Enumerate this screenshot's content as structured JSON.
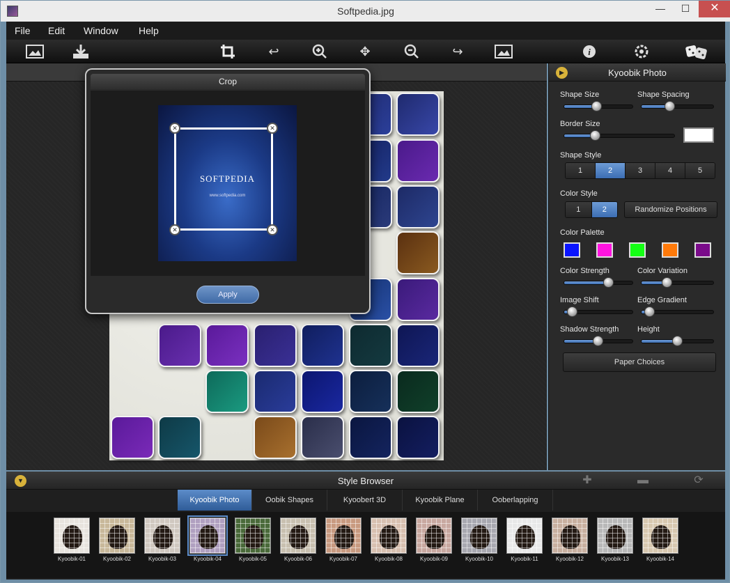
{
  "window": {
    "title": "Softpedia.jpg",
    "minimize": "—",
    "maximize": "☐",
    "close": "✕"
  },
  "menu": [
    "File",
    "Edit",
    "Window",
    "Help"
  ],
  "toolbar": {
    "icons": [
      "open-image-icon",
      "save-icon",
      "crop-icon",
      "undo-icon",
      "zoom-in-icon",
      "move-icon",
      "zoom-out-icon",
      "redo-icon",
      "export-image-icon",
      "info-icon",
      "settings-icon",
      "dice-icon"
    ]
  },
  "crop": {
    "title": "Crop",
    "image_logo": "SOFTPEDIA",
    "image_url": "www.softpedia.com",
    "apply_label": "Apply"
  },
  "panel": {
    "title": "Kyoobik Photo",
    "shape_size": {
      "label": "Shape Size",
      "value": 0.47
    },
    "shape_spacing": {
      "label": "Shape Spacing",
      "value": 0.38
    },
    "border_size": {
      "label": "Border Size",
      "value": 0.26
    },
    "shape_style": {
      "label": "Shape Style",
      "options": [
        "1",
        "2",
        "3",
        "4",
        "5"
      ],
      "selected": "2"
    },
    "color_style": {
      "label": "Color Style",
      "options": [
        "1",
        "2"
      ],
      "selected": "2"
    },
    "randomize_label": "Randomize Positions",
    "palette": {
      "label": "Color Palette",
      "colors": [
        "#0a14ff",
        "#ff14e0",
        "#14ff14",
        "#ff7a0a",
        "#7a0a8a"
      ]
    },
    "color_strength": {
      "label": "Color Strength",
      "value": 0.68
    },
    "color_variation": {
      "label": "Color Variation",
      "value": 0.33
    },
    "image_shift": {
      "label": "Image Shift",
      "value": 0.05
    },
    "edge_gradient": {
      "label": "Edge Gradient",
      "value": 0.05
    },
    "shadow_strength": {
      "label": "Shadow Strength",
      "value": 0.49
    },
    "height": {
      "label": "Height",
      "value": 0.5
    },
    "paper_choices_label": "Paper Choices"
  },
  "style_browser": {
    "title": "Style Browser",
    "tabs": [
      "Kyoobik Photo",
      "Oobik Shapes",
      "Kyoobert 3D",
      "Kyoobik Plane",
      "Ooberlapping"
    ],
    "selected_tab": "Kyoobik Photo",
    "thumbs": [
      "Kyoobik-01",
      "Kyoobik-02",
      "Kyoobik-03",
      "Kyoobik-04",
      "Kyoobik-05",
      "Kyoobik-06",
      "Kyoobik-07",
      "Kyoobik-08",
      "Kyoobik-09",
      "Kyoobik-10",
      "Kyoobik-11",
      "Kyoobik-12",
      "Kyoobik-13",
      "Kyoobik-14"
    ],
    "selected_thumb": "Kyoobik-04"
  }
}
